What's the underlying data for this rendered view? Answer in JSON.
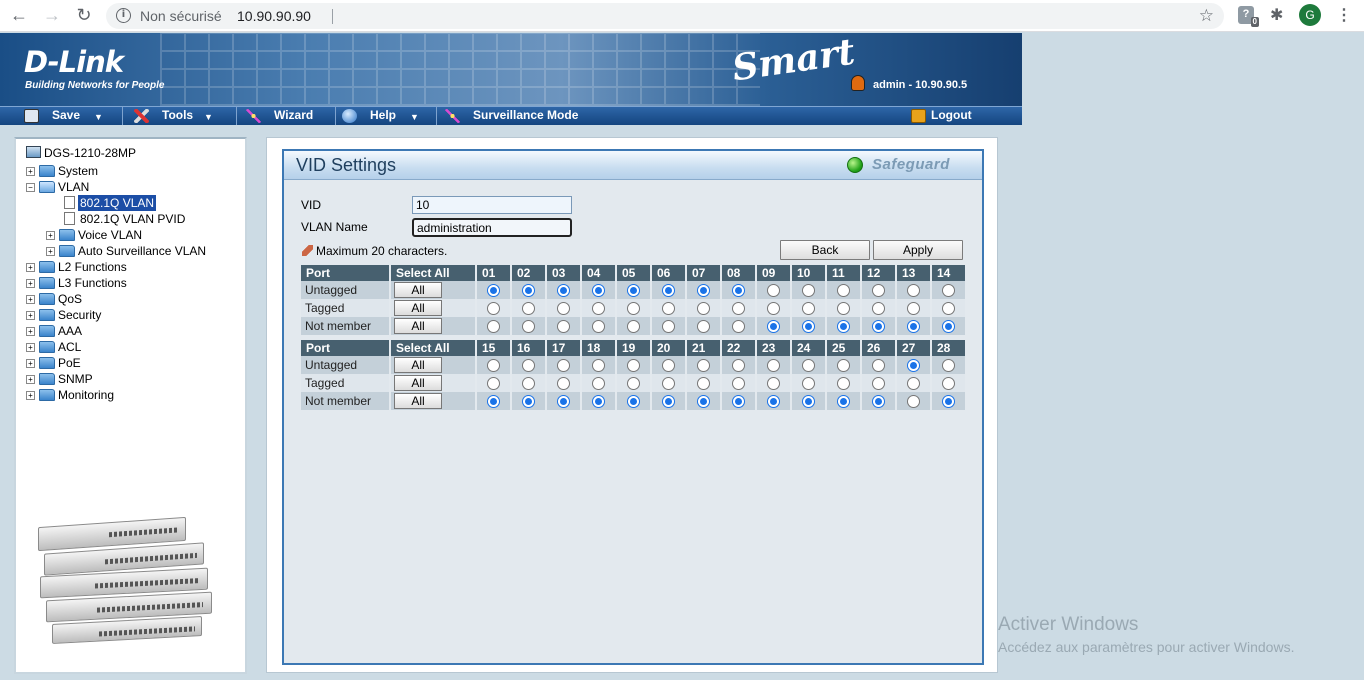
{
  "browser": {
    "security_label": "Non sécurisé",
    "url": "10.90.90.90",
    "avatar_letter": "G",
    "extension_badge": "0"
  },
  "header": {
    "brand": "D-Link",
    "tagline": "Building Networks for People",
    "product_line": "Smart",
    "user_info": "admin - 10.90.90.5"
  },
  "menu": {
    "save": "Save",
    "tools": "Tools",
    "wizard": "Wizard",
    "help": "Help",
    "surveillance": "Surveillance Mode",
    "logout": "Logout"
  },
  "tree": {
    "root": "DGS-1210-28MP",
    "items": [
      "System",
      "VLAN",
      "802.1Q VLAN",
      "802.1Q VLAN PVID",
      "Voice VLAN",
      "Auto Surveillance VLAN",
      "L2 Functions",
      "L3 Functions",
      "QoS",
      "Security",
      "AAA",
      "ACL",
      "PoE",
      "SNMP",
      "Monitoring"
    ],
    "selected": "802.1Q VLAN"
  },
  "panel": {
    "title": "VID Settings",
    "safeguard": "Safeguard",
    "vid_label": "VID",
    "vid_value": "10",
    "vlan_name_label": "VLAN Name",
    "vlan_name_value": "administration",
    "hint": "Maximum 20 characters.",
    "back_label": "Back",
    "apply_label": "Apply"
  },
  "port_table": {
    "col_port": "Port",
    "col_select_all": "Select All",
    "all_label": "All",
    "row_labels": [
      "Untagged",
      "Tagged",
      "Not member"
    ],
    "group1_ports": [
      "01",
      "02",
      "03",
      "04",
      "05",
      "06",
      "07",
      "08",
      "09",
      "10",
      "11",
      "12",
      "13",
      "14"
    ],
    "group1_selected": [
      0,
      0,
      0,
      0,
      0,
      0,
      0,
      0,
      2,
      2,
      2,
      2,
      2,
      2
    ],
    "group2_ports": [
      "15",
      "16",
      "17",
      "18",
      "19",
      "20",
      "21",
      "22",
      "23",
      "24",
      "25",
      "26",
      "27",
      "28"
    ],
    "group2_selected": [
      2,
      2,
      2,
      2,
      2,
      2,
      2,
      2,
      2,
      2,
      2,
      2,
      0,
      2
    ]
  },
  "watermark": {
    "title": "Activer Windows",
    "subtitle": "Accédez aux paramètres pour activer Windows."
  },
  "colors": {
    "header_blue": "#1a4e86",
    "menubar_blue": "#14457f",
    "panel_border": "#3c78b4",
    "radio_selected": "#1a73e8",
    "safeguard_green": "#22a31a",
    "table_header": "#47606f"
  }
}
